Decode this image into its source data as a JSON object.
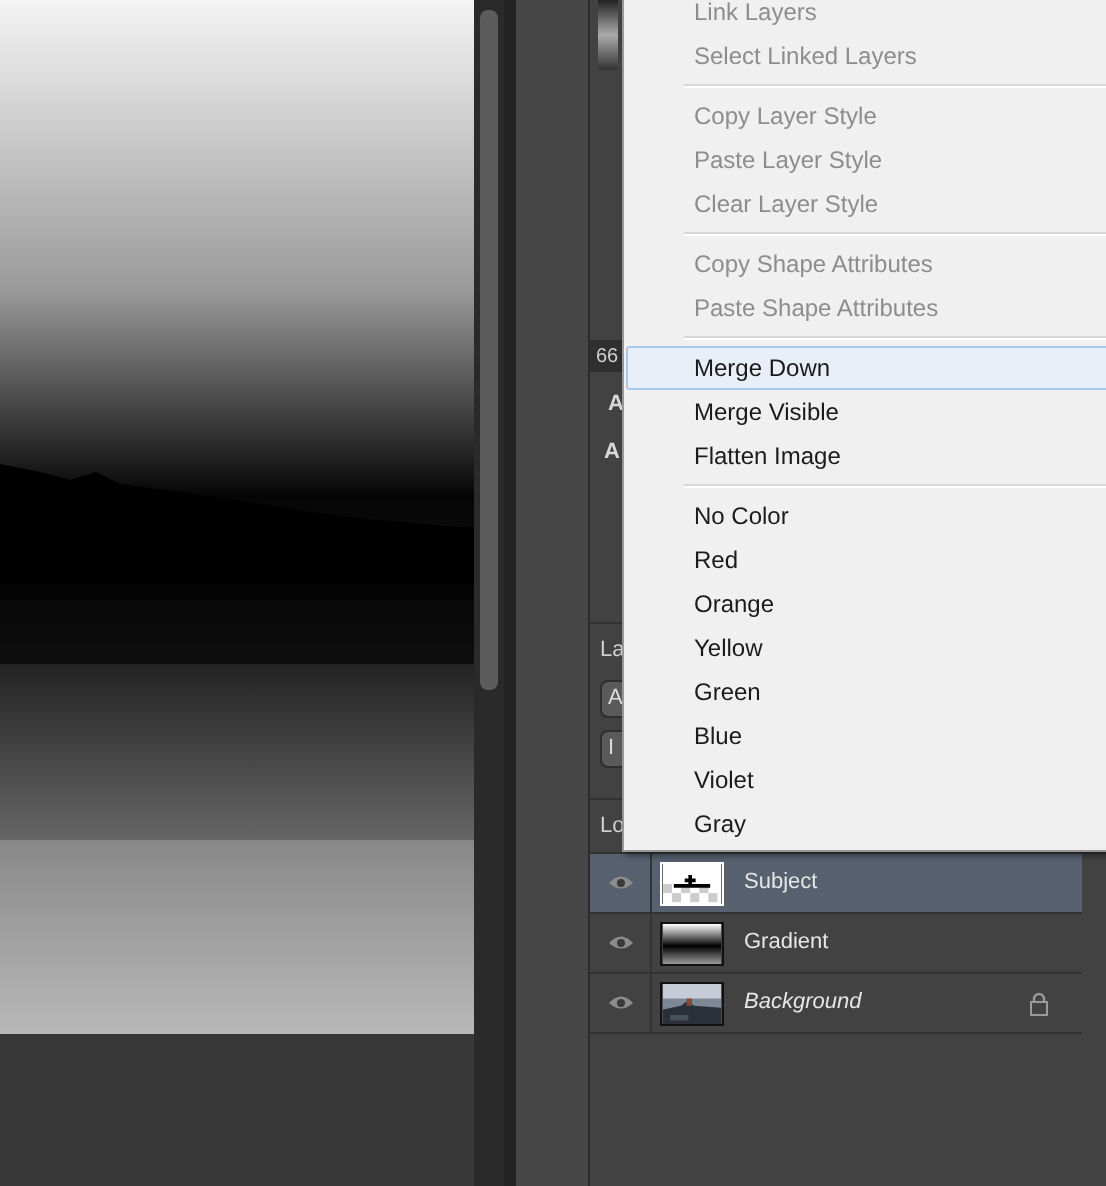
{
  "panel_fragments": {
    "tab_text": "66",
    "adjust_labels": [
      "A",
      "A"
    ],
    "layers_label": "La",
    "buttons": [
      "A",
      "I"
    ],
    "lock_label": "Lo"
  },
  "menu": {
    "sections": [
      [
        {
          "label": "Link Layers",
          "disabled": true,
          "selected": false
        },
        {
          "label": "Select Linked Layers",
          "disabled": true,
          "selected": false
        }
      ],
      [
        {
          "label": "Copy Layer Style",
          "disabled": true,
          "selected": false
        },
        {
          "label": "Paste Layer Style",
          "disabled": true,
          "selected": false
        },
        {
          "label": "Clear Layer Style",
          "disabled": true,
          "selected": false
        }
      ],
      [
        {
          "label": "Copy Shape Attributes",
          "disabled": true,
          "selected": false
        },
        {
          "label": "Paste Shape Attributes",
          "disabled": true,
          "selected": false
        }
      ],
      [
        {
          "label": "Merge Down",
          "disabled": false,
          "selected": true
        },
        {
          "label": "Merge Visible",
          "disabled": false,
          "selected": false
        },
        {
          "label": "Flatten Image",
          "disabled": false,
          "selected": false
        }
      ],
      [
        {
          "label": "No Color",
          "disabled": false,
          "selected": false
        },
        {
          "label": "Red",
          "disabled": false,
          "selected": false
        },
        {
          "label": "Orange",
          "disabled": false,
          "selected": false
        },
        {
          "label": "Yellow",
          "disabled": false,
          "selected": false
        },
        {
          "label": "Green",
          "disabled": false,
          "selected": false
        },
        {
          "label": "Blue",
          "disabled": false,
          "selected": false
        },
        {
          "label": "Violet",
          "disabled": false,
          "selected": false
        },
        {
          "label": "Gray",
          "disabled": false,
          "selected": false
        }
      ]
    ]
  },
  "layers": [
    {
      "name": "Subject",
      "kind": "shape",
      "selected": true,
      "visible": true,
      "locked": false
    },
    {
      "name": "Gradient",
      "kind": "gradient",
      "selected": false,
      "visible": true,
      "locked": false
    },
    {
      "name": "Background",
      "kind": "background",
      "selected": false,
      "visible": true,
      "locked": true
    }
  ]
}
